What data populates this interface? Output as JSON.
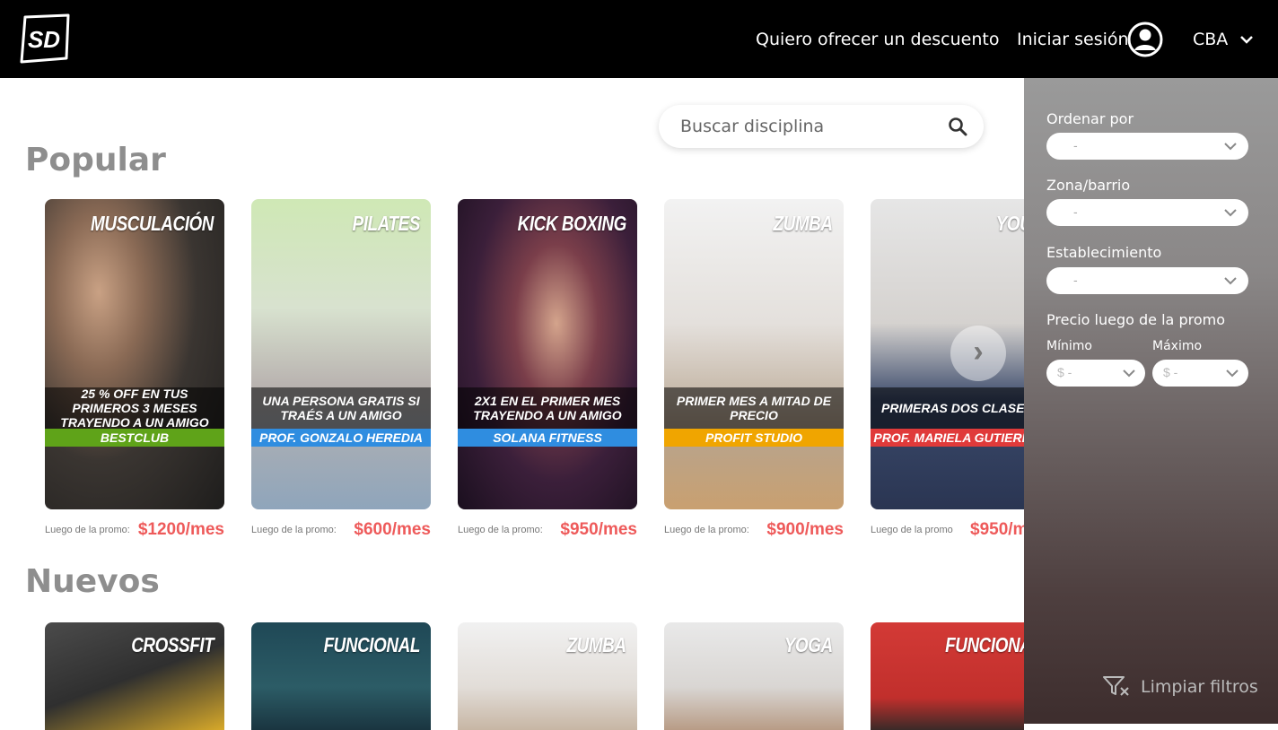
{
  "header": {
    "logo_text": "SD",
    "discount_link": "Quiero ofrecer un descuento",
    "login_link": "Iniciar sesión",
    "city": "CBA"
  },
  "search": {
    "placeholder": "Buscar disciplina"
  },
  "sections": {
    "popular_title": "Popular",
    "nuevos_title": "Nuevos"
  },
  "popular": [
    {
      "discipline": "MUSCULACIÓN",
      "promo": "25 % OFF EN TUS PRIMEROS 3 MESES TRAYENDO A UN AMIGO",
      "studio": "BESTCLUB",
      "band_color": "#5fa319",
      "price_label": "Luego de la promo:",
      "price": "$1200/mes"
    },
    {
      "discipline": "PILATES",
      "promo": "UNA PERSONA GRATIS SI TRAÉS A UN AMIGO",
      "studio": "PROF. GONZALO HEREDIA",
      "band_color": "#2f8de0",
      "price_label": "Luego de la promo:",
      "price": "$600/mes"
    },
    {
      "discipline": "KICK BOXING",
      "promo": "2X1 EN EL PRIMER MES TRAYENDO A UN AMIGO",
      "studio": "SOLANA FITNESS",
      "band_color": "#2f8de0",
      "price_label": "Luego de la promo:",
      "price": "$950/mes"
    },
    {
      "discipline": "ZUMBA",
      "promo": "PRIMER MES A MITAD DE PRECIO",
      "studio": "PROFIT STUDIO",
      "band_color": "#f0a500",
      "price_label": "Luego de la promo:",
      "price": "$900/mes"
    },
    {
      "discipline": "YOU",
      "promo": "PRIMERAS DOS CLASES GRAT",
      "studio": "PROF. MARIELA GUTIERREZ",
      "band_color": "#e03a3a",
      "price_label": "Luego de la promo",
      "price": "$950/m"
    }
  ],
  "nuevos": [
    {
      "discipline": "CROSSFIT"
    },
    {
      "discipline": "FUNCIONAL"
    },
    {
      "discipline": "ZUMBA"
    },
    {
      "discipline": "YOGA"
    },
    {
      "discipline": "FUNCIONA"
    }
  ],
  "filters": {
    "order_label": "Ordenar por",
    "order_value": "-",
    "zone_label": "Zona/barrio",
    "zone_value": "-",
    "establishment_label": "Establecimiento",
    "establishment_value": "-",
    "price_label": "Precio luego de la promo",
    "min_label": "Mínimo",
    "min_value": "$ -",
    "max_label": "Máximo",
    "max_value": "$ -",
    "clear_label": "Limpiar filtros"
  }
}
